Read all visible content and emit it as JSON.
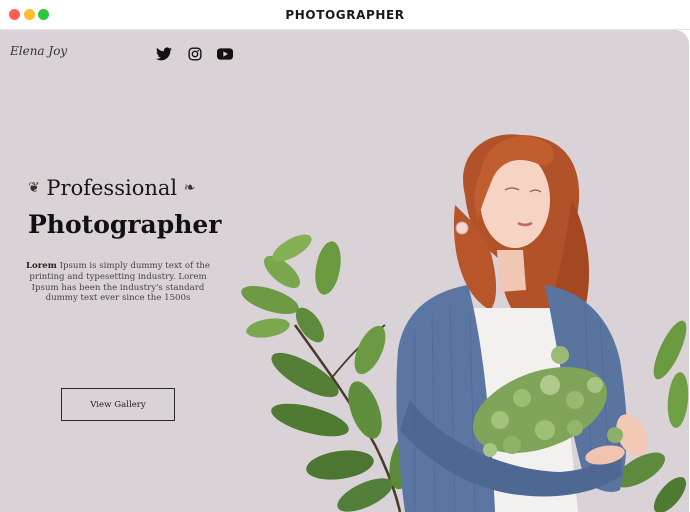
{
  "window": {
    "title": "PHOTOGRAPHER"
  },
  "header": {
    "logo": "Elena Joy",
    "social": [
      {
        "icon": "twitter-icon"
      },
      {
        "icon": "instagram-icon"
      },
      {
        "icon": "youtube-icon"
      }
    ]
  },
  "hero": {
    "line1": "Professional",
    "line2": "Photographer",
    "description_lead": "Lorem",
    "description_rest": " Ipsum is simply dummy text of the printing and typesetting industry. Lorem Ipsum has been the industry's standard dummy text ever since the 1500s",
    "cta_label": "View Gallery"
  },
  "colors": {
    "page_background": "#d9d2d6",
    "sweater": "#5b76a3",
    "hair": "#b5532a",
    "leaf": "#5d8a3c"
  }
}
